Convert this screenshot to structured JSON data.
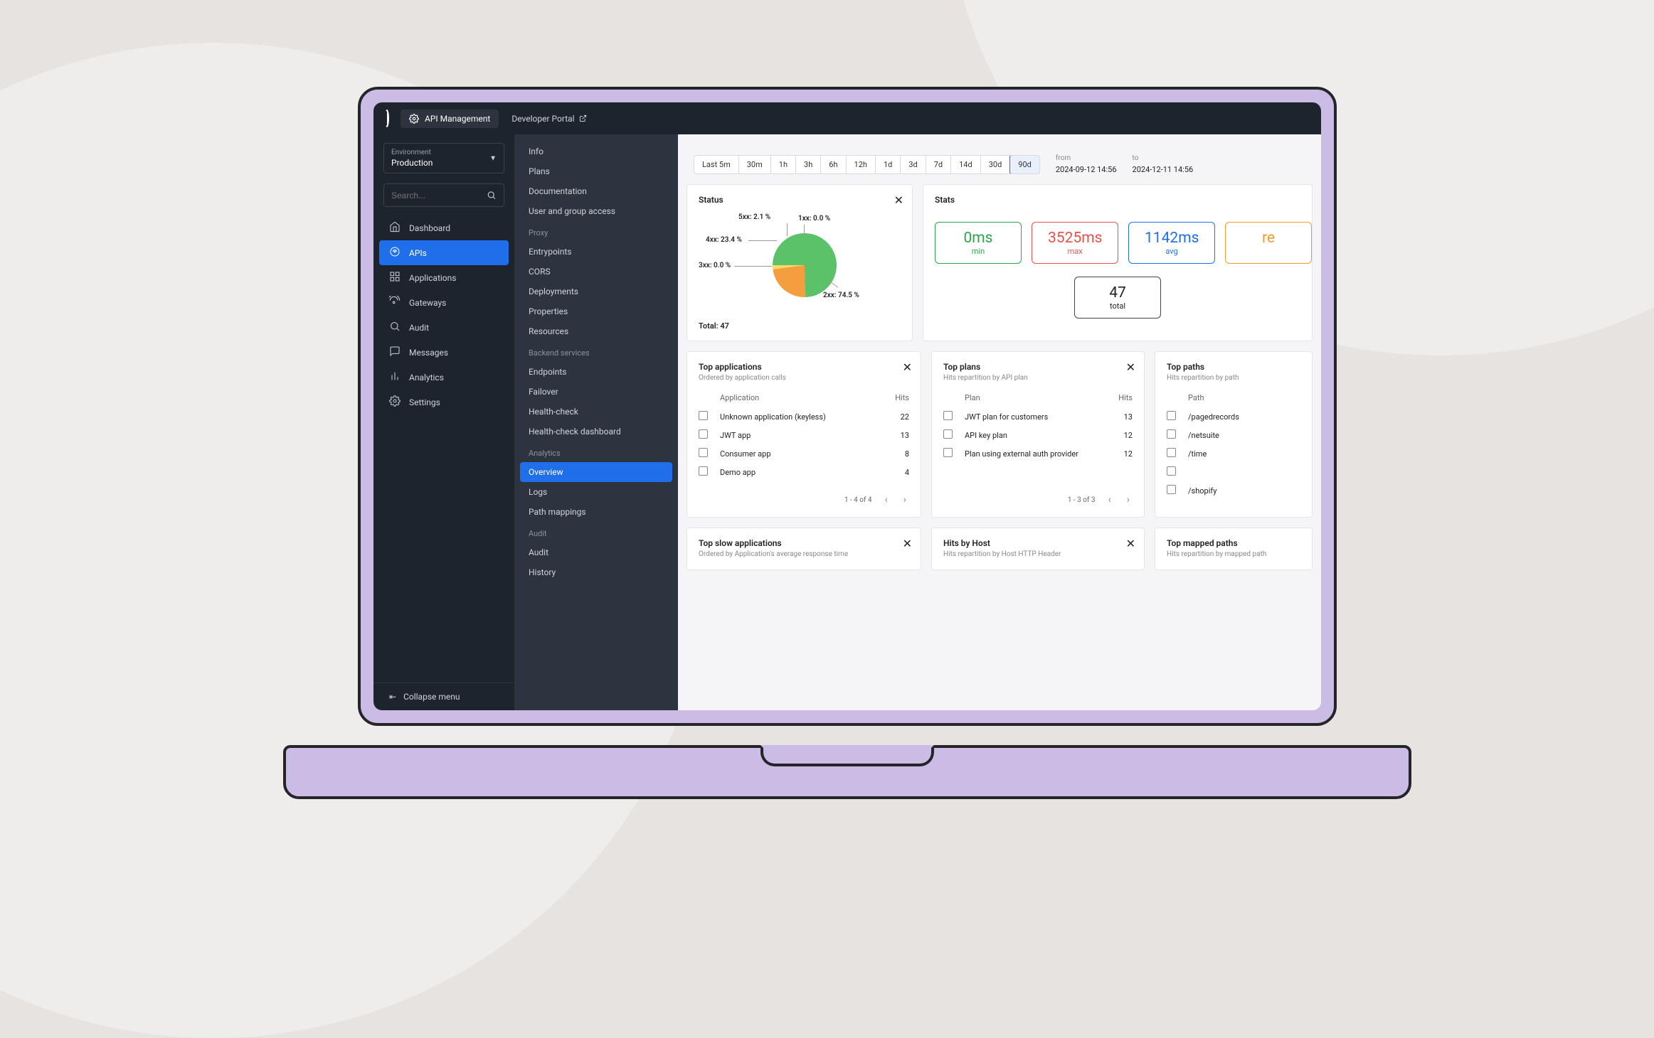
{
  "topbar": {
    "product_label": "API Management",
    "dev_portal_label": "Developer Portal"
  },
  "environment": {
    "label": "Environment",
    "value": "Production"
  },
  "search": {
    "placeholder": "Search..."
  },
  "nav1": {
    "items": [
      {
        "key": "dashboard",
        "label": "Dashboard"
      },
      {
        "key": "apis",
        "label": "APIs"
      },
      {
        "key": "applications",
        "label": "Applications"
      },
      {
        "key": "gateways",
        "label": "Gateways"
      },
      {
        "key": "audit",
        "label": "Audit"
      },
      {
        "key": "messages",
        "label": "Messages"
      },
      {
        "key": "analytics",
        "label": "Analytics"
      },
      {
        "key": "settings",
        "label": "Settings"
      }
    ],
    "active": "apis",
    "collapse_label": "Collapse menu"
  },
  "nav2": {
    "groups": [
      {
        "items": [
          "Info",
          "Plans",
          "Documentation",
          "User and group access"
        ]
      },
      {
        "header": "Proxy",
        "items": [
          "Entrypoints",
          "CORS",
          "Deployments",
          "Properties",
          "Resources"
        ]
      },
      {
        "header": "Backend services",
        "items": [
          "Endpoints",
          "Failover",
          "Health-check",
          "Health-check dashboard"
        ]
      },
      {
        "header": "Analytics",
        "items": [
          "Overview",
          "Logs",
          "Path mappings"
        ]
      },
      {
        "header": "Audit",
        "items": [
          "Audit",
          "History"
        ]
      }
    ],
    "active": "Overview"
  },
  "time_range": {
    "options": [
      "Last 5m",
      "30m",
      "1h",
      "3h",
      "6h",
      "12h",
      "1d",
      "3d",
      "7d",
      "14d",
      "30d",
      "90d"
    ],
    "active": "90d",
    "from_label": "from",
    "from_value": "2024-09-12 14:56",
    "to_label": "to",
    "to_value": "2024-12-11 14:56"
  },
  "status": {
    "title": "Status",
    "total_label": "Total: 47"
  },
  "chart_data": {
    "type": "pie",
    "title": "Status",
    "series": [
      {
        "name": "1xx",
        "value": 0.0,
        "label": "1xx: 0.0 %",
        "color": "#e5534b"
      },
      {
        "name": "2xx",
        "value": 74.5,
        "label": "2xx: 74.5 %",
        "color": "#5cc26a"
      },
      {
        "name": "3xx",
        "value": 0.0,
        "label": "3xx: 0.0 %",
        "color": "#5b9bd5"
      },
      {
        "name": "4xx",
        "value": 23.4,
        "label": "4xx: 23.4 %",
        "color": "#f59e3f"
      },
      {
        "name": "5xx",
        "value": 2.1,
        "label": "5xx: 2.1 %",
        "color": "#ffd966"
      }
    ],
    "total": 47
  },
  "stats": {
    "title": "Stats",
    "boxes": [
      {
        "value": "0ms",
        "sub": "min",
        "cls": "sb-green"
      },
      {
        "value": "3525ms",
        "sub": "max",
        "cls": "sb-red"
      },
      {
        "value": "1142ms",
        "sub": "avg",
        "cls": "sb-blue"
      },
      {
        "value": "re",
        "sub": "",
        "cls": "sb-orange"
      }
    ],
    "total_box": {
      "value": "47",
      "sub": "total",
      "cls": "sb-plain"
    }
  },
  "top_apps": {
    "title": "Top applications",
    "subtitle": "Ordered by application calls",
    "col_name": "Application",
    "col_hits": "Hits",
    "rows": [
      {
        "name": "Unknown application (keyless)",
        "hits": 22
      },
      {
        "name": "JWT app",
        "hits": 13
      },
      {
        "name": "Consumer app",
        "hits": 8
      },
      {
        "name": "Demo app",
        "hits": 4
      }
    ],
    "pager": "1 - 4 of 4"
  },
  "top_plans": {
    "title": "Top plans",
    "subtitle": "Hits repartition by API plan",
    "col_name": "Plan",
    "col_hits": "Hits",
    "rows": [
      {
        "name": "JWT plan for customers",
        "hits": 13
      },
      {
        "name": "API key plan",
        "hits": 12
      },
      {
        "name": "Plan using external auth provider",
        "hits": 12
      }
    ],
    "pager": "1 - 3 of 3"
  },
  "top_paths": {
    "title": "Top paths",
    "subtitle": "Hits repartition by path",
    "col_name": "Path",
    "rows": [
      {
        "name": "/pagedrecords"
      },
      {
        "name": "/netsuite"
      },
      {
        "name": "/time"
      },
      {
        "name": ""
      },
      {
        "name": "/shopify"
      }
    ]
  },
  "bottom": {
    "slow_apps": {
      "title": "Top slow applications",
      "subtitle": "Ordered by Application's average response time"
    },
    "hits_host": {
      "title": "Hits by Host",
      "subtitle": "Hits repartition by Host HTTP Header"
    },
    "mapped_paths": {
      "title": "Top mapped paths",
      "subtitle": "Hits repartition by mapped path"
    }
  }
}
